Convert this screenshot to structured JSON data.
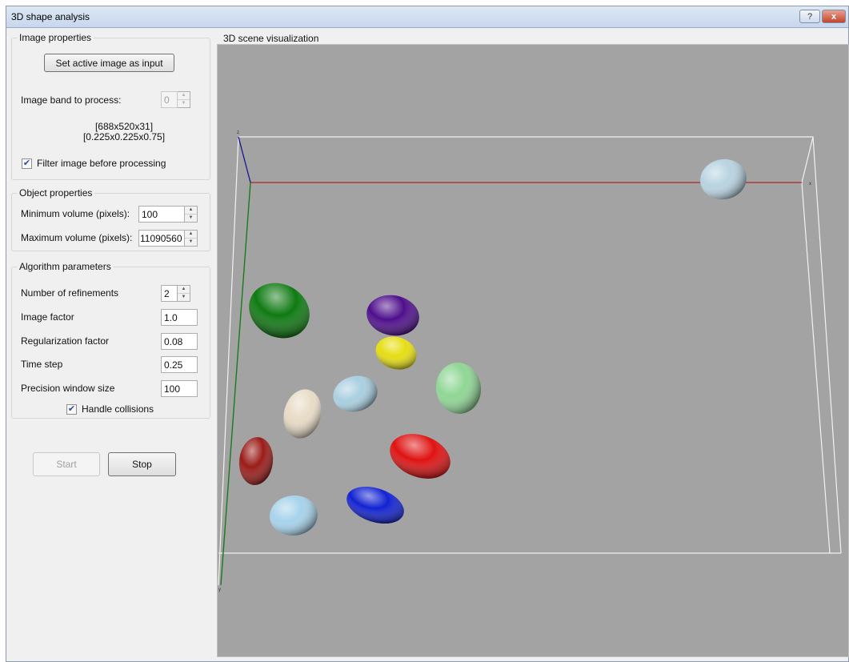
{
  "window": {
    "title": "3D shape analysis",
    "help_button": "?",
    "close_button": "x"
  },
  "image_properties": {
    "group_title": "Image properties",
    "set_input_button": "Set active image as input",
    "band_label": "Image band to process:",
    "band_value": "0",
    "dimensions": "[688x520x31]",
    "voxel_size": "[0.225x0.225x0.75]",
    "filter_checkbox_checked": true,
    "filter_label": "Filter image before processing"
  },
  "object_properties": {
    "group_title": "Object properties",
    "min_volume_label": "Minimum volume (pixels):",
    "min_volume_value": "100",
    "max_volume_label": "Maximum volume (pixels):",
    "max_volume_value": "11090560"
  },
  "algorithm": {
    "group_title": "Algorithm parameters",
    "refinements_label": "Number of refinements",
    "refinements_value": "2",
    "image_factor_label": "Image factor",
    "image_factor_value": "1.0",
    "regularization_label": "Regularization factor",
    "regularization_value": "0.08",
    "time_step_label": "Time step",
    "time_step_value": "0.25",
    "precision_label": "Precision window size",
    "precision_value": "100",
    "collisions_checkbox_checked": true,
    "collisions_label": "Handle collisions"
  },
  "actions": {
    "start_label": "Start",
    "stop_label": "Stop"
  },
  "scene": {
    "label": "3D scene visualization",
    "background_color": "#a3a3a3",
    "axis_colors": {
      "x": "#a21818",
      "y": "#1a7a1a",
      "z": "#1a1a8a"
    },
    "objects": [
      {
        "name": "light-blue-cell-top",
        "color": "#b7d3e0"
      },
      {
        "name": "green-cell",
        "color": "#0f7a12"
      },
      {
        "name": "purple-cell",
        "color": "#4f0f8c"
      },
      {
        "name": "yellow-cell",
        "color": "#e6de12"
      },
      {
        "name": "light-green-cell",
        "color": "#8fd694"
      },
      {
        "name": "beige-cell",
        "color": "#e8dcc6"
      },
      {
        "name": "light-blue-cell-middle",
        "color": "#a9cfe0"
      },
      {
        "name": "red-cell",
        "color": "#df1212"
      },
      {
        "name": "dark-red-cell",
        "color": "#9a1c18"
      },
      {
        "name": "light-blue-cell-bottom",
        "color": "#a6d2ea"
      },
      {
        "name": "blue-cell",
        "color": "#1222d2"
      }
    ]
  }
}
